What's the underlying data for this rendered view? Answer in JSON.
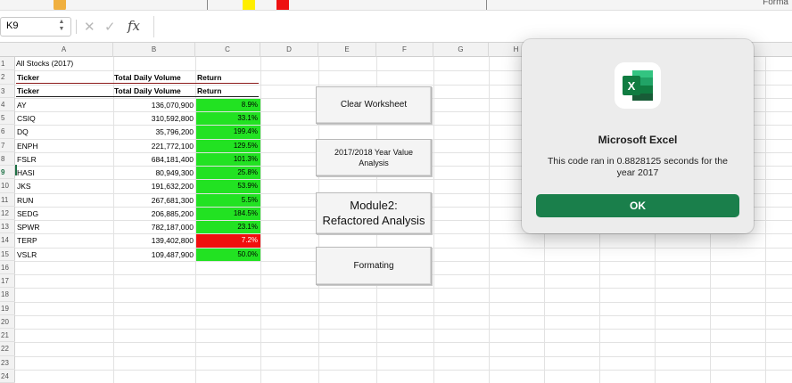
{
  "ribbon": {
    "format_label": "Forma"
  },
  "formula_bar": {
    "name_box": "K9",
    "fx_label": "fx",
    "cancel_glyph": "✕",
    "enter_glyph": "✓",
    "formula_value": ""
  },
  "columns": [
    "A",
    "B",
    "C",
    "D",
    "E",
    "F",
    "G",
    "H"
  ],
  "rows": [
    "1",
    "2",
    "3",
    "4",
    "5",
    "6",
    "7",
    "8",
    "9",
    "10",
    "11",
    "12",
    "13",
    "14",
    "15",
    "16",
    "17",
    "18",
    "19",
    "20",
    "21",
    "22",
    "23",
    "24"
  ],
  "sheet": {
    "title": "All Stocks (2017)",
    "header_row_2": {
      "ticker": "Ticker",
      "volume": "Total Daily Volume",
      "return": "Return"
    },
    "header_row_3": {
      "ticker": "Ticker",
      "volume": "Total Daily Volume",
      "return": "Return"
    },
    "data": [
      {
        "ticker": "AY",
        "volume": "136,070,900",
        "return": "8.9%",
        "status": "positive"
      },
      {
        "ticker": "CSIQ",
        "volume": "310,592,800",
        "return": "33.1%",
        "status": "positive"
      },
      {
        "ticker": "DQ",
        "volume": "35,796,200",
        "return": "199.4%",
        "status": "positive"
      },
      {
        "ticker": "ENPH",
        "volume": "221,772,100",
        "return": "129.5%",
        "status": "positive"
      },
      {
        "ticker": "FSLR",
        "volume": "684,181,400",
        "return": "101.3%",
        "status": "positive"
      },
      {
        "ticker": "HASI",
        "volume": "80,949,300",
        "return": "25.8%",
        "status": "positive"
      },
      {
        "ticker": "JKS",
        "volume": "191,632,200",
        "return": "53.9%",
        "status": "positive"
      },
      {
        "ticker": "RUN",
        "volume": "267,681,300",
        "return": "5.5%",
        "status": "positive"
      },
      {
        "ticker": "SEDG",
        "volume": "206,885,200",
        "return": "184.5%",
        "status": "positive"
      },
      {
        "ticker": "SPWR",
        "volume": "782,187,000",
        "return": "23.1%",
        "status": "positive"
      },
      {
        "ticker": "TERP",
        "volume": "139,402,800",
        "return": "7.2%",
        "status": "negative"
      },
      {
        "ticker": "VSLR",
        "volume": "109,487,900",
        "return": "50.0%",
        "status": "positive"
      }
    ],
    "colors": {
      "positive": "#22e222",
      "negative": "#f10e0e"
    }
  },
  "buttons": {
    "clear": "Clear Worksheet",
    "year_line1": "2017/2018 Year Value",
    "year_line2": "Analysis",
    "module_line1": "Module2:",
    "module_line2": "Refactored Analysis",
    "formatting": "Formating"
  },
  "dialog": {
    "title": "Microsoft Excel",
    "message": "This code ran in 0.8828125 seconds for the year 2017",
    "ok_label": "OK",
    "icon": "excel-app-icon",
    "icon_letter": "X",
    "accent_color": "#1a7f4b"
  }
}
